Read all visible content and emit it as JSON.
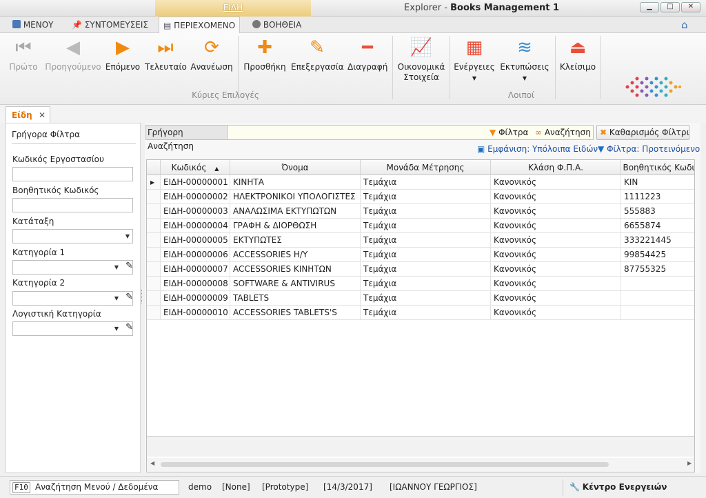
{
  "window": {
    "context_tab": "ΕΙΔΗ",
    "title_app": "Explorer",
    "title_sep": " - ",
    "title_module": "Books Management 1"
  },
  "menu_tabs": [
    "ΜΕΝΟΥ",
    "ΣΥΝΤΟΜΕΥΣΕΙΣ",
    "ΠΕΡΙΕΧΟΜΕΝΟ",
    "ΒΟΗΘΕΙΑ"
  ],
  "ribbon": {
    "first": "Πρώτο",
    "previous": "Προηγούμενο",
    "next": "Επόμενο",
    "last": "Τελευταίο",
    "refresh": "Ανανέωση",
    "add": "Προσθήκη",
    "edit": "Επεξεργασία",
    "delete": "Διαγραφή",
    "financial_1": "Οικονομικά",
    "financial_2": "Στοιχεία",
    "actions": "Ενέργειες",
    "prints": "Εκτυπώσεις",
    "close": "Κλείσιμο",
    "group_main": "Κύριες Επιλογές",
    "group_other": "Λοιποί"
  },
  "doc_tab": "Είδη",
  "filters": {
    "title": "Γρήγορα Φίλτρα",
    "factory_code": "Κωδικός Εργοστασίου",
    "aux_code": "Βοηθητικός Κωδικός",
    "classification": "Κατάταξη",
    "category1": "Κατηγορία 1",
    "category2": "Κατηγορία 2",
    "accounting_category": "Λογιστική Κατηγορία"
  },
  "search": {
    "label": "Γρήγορη Αναζήτηση",
    "value": "",
    "filters_btn": "Φίλτρα",
    "search_btn": "Αναζήτηση",
    "clear_btn": "Καθαρισμός Φίλτρων",
    "view_link": "Εμφάνιση: Υπόλοιπα Ειδών",
    "filter_link": "Φίλτρα: Προτεινόμενο"
  },
  "table": {
    "columns": [
      "Κωδικός",
      "Όνομα",
      "Μονάδα Μέτρησης",
      "Κλάση Φ.Π.Α.",
      "Βοηθητικός Κωδι"
    ],
    "rows": [
      [
        "ΕΙΔΗ-00000001",
        "ΚΙΝΗΤΑ",
        "Τεμάχια",
        "Κανονικός",
        "KIN"
      ],
      [
        "ΕΙΔΗ-00000002",
        "ΗΛΕΚΤΡΟΝΙΚΟΙ ΥΠΟΛΟΓΙΣΤΕΣ",
        "Τεμάχια",
        "Κανονικός",
        "1111223"
      ],
      [
        "ΕΙΔΗ-00000003",
        "ΑΝΑΛΩΣΙΜΑ ΕΚΤΥΠΩΤΩΝ",
        "Τεμάχια",
        "Κανονικός",
        "555883"
      ],
      [
        "ΕΙΔΗ-00000004",
        "ΓΡΑΦΗ & ΔΙΟΡΘΩΣΗ",
        "Τεμάχια",
        "Κανονικός",
        "6655874"
      ],
      [
        "ΕΙΔΗ-00000005",
        "ΕΚΤΥΠΩΤΕΣ",
        "Τεμάχια",
        "Κανονικός",
        "333221445"
      ],
      [
        "ΕΙΔΗ-00000006",
        "ACCESSORIES H/Y",
        "Τεμάχια",
        "Κανονικός",
        "99854425"
      ],
      [
        "ΕΙΔΗ-00000007",
        "ACCESSORIES ΚΙΝΗΤΩΝ",
        "Τεμάχια",
        "Κανονικός",
        "87755325"
      ],
      [
        "ΕΙΔΗ-00000008",
        "SOFTWARE & ANTIVIRUS",
        "Τεμάχια",
        "Κανονικός",
        ""
      ],
      [
        "ΕΙΔΗ-00000009",
        "TABLETS",
        "Τεμάχια",
        "Κανονικός",
        ""
      ],
      [
        "ΕΙΔΗ-00000010",
        "ACCESSORIES TABLETS'S",
        "Τεμάχια",
        "Κανονικός",
        ""
      ]
    ]
  },
  "status": {
    "key": "F10",
    "key_label": "Αναζήτηση Μενού / Δεδομένα",
    "user": "demo",
    "none": "[None]",
    "prototype": "[Prototype]",
    "date": "[14/3/2017]",
    "name": "[ΙΩΑΝΝΟΥ ΓΕΩΡΓΙΟΣ]",
    "action_center": "Κέντρο Ενεργειών"
  },
  "colors": {
    "accent_orange": "#f08a10",
    "link_blue": "#1d4fa0",
    "delete_red": "#e8503a"
  }
}
